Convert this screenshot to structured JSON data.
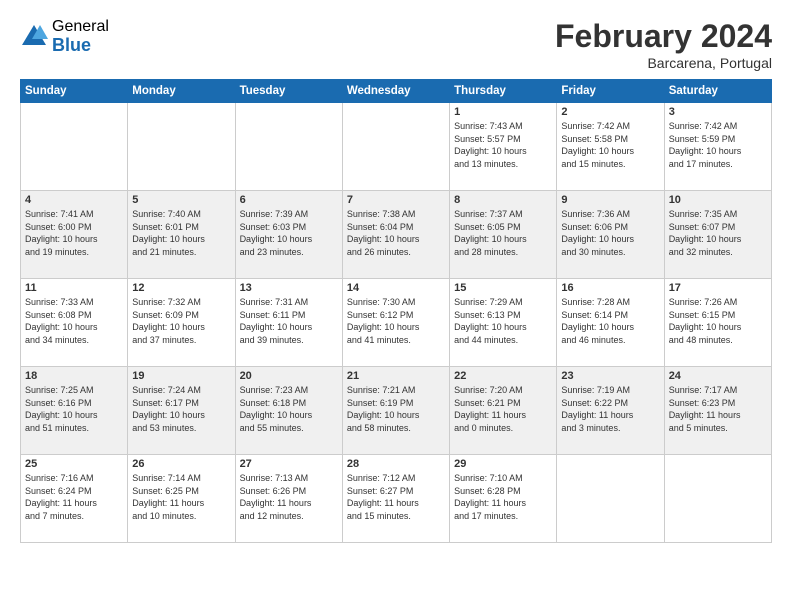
{
  "header": {
    "logo_general": "General",
    "logo_blue": "Blue",
    "month_title": "February 2024",
    "location": "Barcarena, Portugal"
  },
  "days_of_week": [
    "Sunday",
    "Monday",
    "Tuesday",
    "Wednesday",
    "Thursday",
    "Friday",
    "Saturday"
  ],
  "weeks": [
    [
      {
        "num": "",
        "info": ""
      },
      {
        "num": "",
        "info": ""
      },
      {
        "num": "",
        "info": ""
      },
      {
        "num": "",
        "info": ""
      },
      {
        "num": "1",
        "info": "Sunrise: 7:43 AM\nSunset: 5:57 PM\nDaylight: 10 hours\nand 13 minutes."
      },
      {
        "num": "2",
        "info": "Sunrise: 7:42 AM\nSunset: 5:58 PM\nDaylight: 10 hours\nand 15 minutes."
      },
      {
        "num": "3",
        "info": "Sunrise: 7:42 AM\nSunset: 5:59 PM\nDaylight: 10 hours\nand 17 minutes."
      }
    ],
    [
      {
        "num": "4",
        "info": "Sunrise: 7:41 AM\nSunset: 6:00 PM\nDaylight: 10 hours\nand 19 minutes."
      },
      {
        "num": "5",
        "info": "Sunrise: 7:40 AM\nSunset: 6:01 PM\nDaylight: 10 hours\nand 21 minutes."
      },
      {
        "num": "6",
        "info": "Sunrise: 7:39 AM\nSunset: 6:03 PM\nDaylight: 10 hours\nand 23 minutes."
      },
      {
        "num": "7",
        "info": "Sunrise: 7:38 AM\nSunset: 6:04 PM\nDaylight: 10 hours\nand 26 minutes."
      },
      {
        "num": "8",
        "info": "Sunrise: 7:37 AM\nSunset: 6:05 PM\nDaylight: 10 hours\nand 28 minutes."
      },
      {
        "num": "9",
        "info": "Sunrise: 7:36 AM\nSunset: 6:06 PM\nDaylight: 10 hours\nand 30 minutes."
      },
      {
        "num": "10",
        "info": "Sunrise: 7:35 AM\nSunset: 6:07 PM\nDaylight: 10 hours\nand 32 minutes."
      }
    ],
    [
      {
        "num": "11",
        "info": "Sunrise: 7:33 AM\nSunset: 6:08 PM\nDaylight: 10 hours\nand 34 minutes."
      },
      {
        "num": "12",
        "info": "Sunrise: 7:32 AM\nSunset: 6:09 PM\nDaylight: 10 hours\nand 37 minutes."
      },
      {
        "num": "13",
        "info": "Sunrise: 7:31 AM\nSunset: 6:11 PM\nDaylight: 10 hours\nand 39 minutes."
      },
      {
        "num": "14",
        "info": "Sunrise: 7:30 AM\nSunset: 6:12 PM\nDaylight: 10 hours\nand 41 minutes."
      },
      {
        "num": "15",
        "info": "Sunrise: 7:29 AM\nSunset: 6:13 PM\nDaylight: 10 hours\nand 44 minutes."
      },
      {
        "num": "16",
        "info": "Sunrise: 7:28 AM\nSunset: 6:14 PM\nDaylight: 10 hours\nand 46 minutes."
      },
      {
        "num": "17",
        "info": "Sunrise: 7:26 AM\nSunset: 6:15 PM\nDaylight: 10 hours\nand 48 minutes."
      }
    ],
    [
      {
        "num": "18",
        "info": "Sunrise: 7:25 AM\nSunset: 6:16 PM\nDaylight: 10 hours\nand 51 minutes."
      },
      {
        "num": "19",
        "info": "Sunrise: 7:24 AM\nSunset: 6:17 PM\nDaylight: 10 hours\nand 53 minutes."
      },
      {
        "num": "20",
        "info": "Sunrise: 7:23 AM\nSunset: 6:18 PM\nDaylight: 10 hours\nand 55 minutes."
      },
      {
        "num": "21",
        "info": "Sunrise: 7:21 AM\nSunset: 6:19 PM\nDaylight: 10 hours\nand 58 minutes."
      },
      {
        "num": "22",
        "info": "Sunrise: 7:20 AM\nSunset: 6:21 PM\nDaylight: 11 hours\nand 0 minutes."
      },
      {
        "num": "23",
        "info": "Sunrise: 7:19 AM\nSunset: 6:22 PM\nDaylight: 11 hours\nand 3 minutes."
      },
      {
        "num": "24",
        "info": "Sunrise: 7:17 AM\nSunset: 6:23 PM\nDaylight: 11 hours\nand 5 minutes."
      }
    ],
    [
      {
        "num": "25",
        "info": "Sunrise: 7:16 AM\nSunset: 6:24 PM\nDaylight: 11 hours\nand 7 minutes."
      },
      {
        "num": "26",
        "info": "Sunrise: 7:14 AM\nSunset: 6:25 PM\nDaylight: 11 hours\nand 10 minutes."
      },
      {
        "num": "27",
        "info": "Sunrise: 7:13 AM\nSunset: 6:26 PM\nDaylight: 11 hours\nand 12 minutes."
      },
      {
        "num": "28",
        "info": "Sunrise: 7:12 AM\nSunset: 6:27 PM\nDaylight: 11 hours\nand 15 minutes."
      },
      {
        "num": "29",
        "info": "Sunrise: 7:10 AM\nSunset: 6:28 PM\nDaylight: 11 hours\nand 17 minutes."
      },
      {
        "num": "",
        "info": ""
      },
      {
        "num": "",
        "info": ""
      }
    ]
  ]
}
